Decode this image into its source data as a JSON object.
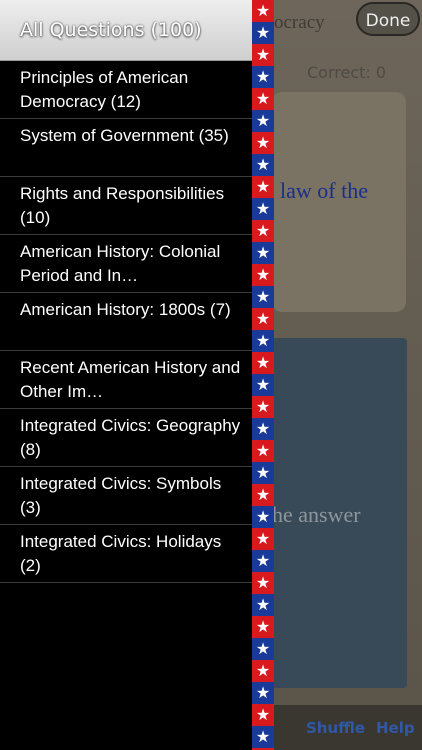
{
  "main": {
    "title": "ocracy",
    "done_label": "Done",
    "correct_label": "Correct: 0",
    "question_partial": "law of the",
    "answer_prompt_partial": "he answer",
    "bottom_bar": {
      "shuffle_label": "Shuffle",
      "help_label": "Help"
    }
  },
  "menu": {
    "header": "All Questions (100)",
    "items": [
      {
        "label": "Principles of American Democracy (12)"
      },
      {
        "label": "System of Government (35)"
      },
      {
        "label": "Rights and Responsibilities (10)"
      },
      {
        "label": "American History: Colonial Period and In…"
      },
      {
        "label": "American History: 1800s (7)"
      },
      {
        "label": "Recent American History and Other Im…"
      },
      {
        "label": "Integrated Civics: Geography (8)"
      },
      {
        "label": "Integrated Civics: Symbols (3)"
      },
      {
        "label": "Integrated Civics: Holidays (2)"
      }
    ]
  },
  "colors": {
    "menu_bg": "#000000",
    "strip_red": "#d8191d",
    "strip_blue": "#1a3a9a",
    "question_text": "#1a2e8c",
    "bottom_button": "#2f58a8"
  },
  "icons": {
    "strip_star": "star-icon"
  }
}
